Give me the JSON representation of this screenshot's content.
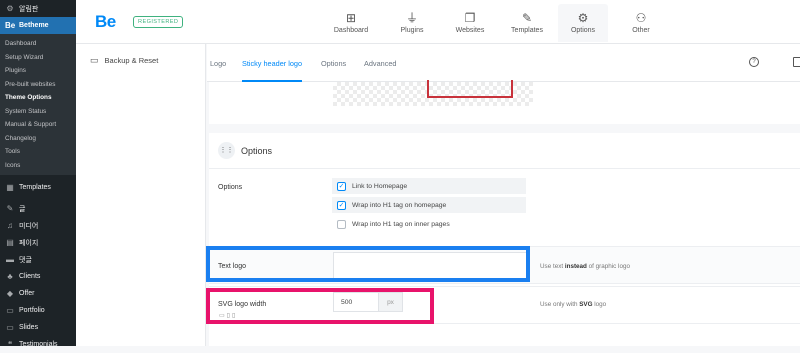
{
  "wp_sidebar": {
    "top_items": [
      {
        "icon": "bell-icon",
        "glyph": "⚙",
        "label": "알림판"
      },
      {
        "icon": "betheme-logo",
        "glyph": "Be",
        "label": "Betheme"
      }
    ],
    "submenu": [
      "Dashboard",
      "Setup Wizard",
      "Plugins",
      "Pre-built websites",
      "Theme Options",
      "System Status",
      "Manual & Support",
      "Changelog",
      "Tools",
      "Icons"
    ],
    "current_submenu": "Theme Options",
    "bottom_items": [
      {
        "icon": "templates-icon",
        "glyph": "▦",
        "label": "Templates"
      },
      {
        "icon": "pin-icon",
        "glyph": "✎",
        "label": "글"
      },
      {
        "icon": "media-icon",
        "glyph": "♫",
        "label": "미디어"
      },
      {
        "icon": "page-icon",
        "glyph": "▤",
        "label": "페이지"
      },
      {
        "icon": "comment-icon",
        "glyph": "▬",
        "label": "댓글"
      },
      {
        "icon": "clients-icon",
        "glyph": "♣",
        "label": "Clients"
      },
      {
        "icon": "offer-icon",
        "glyph": "◆",
        "label": "Offer"
      },
      {
        "icon": "portfolio-icon",
        "glyph": "▭",
        "label": "Portfolio"
      },
      {
        "icon": "slides-icon",
        "glyph": "▭",
        "label": "Slides"
      },
      {
        "icon": "testimonials-icon",
        "glyph": "❝",
        "label": "Testimonials"
      }
    ]
  },
  "header": {
    "logo": "Be",
    "badge": "REGISTERED",
    "tabs": [
      {
        "icon": "dashboard-icon",
        "glyph": "⊞",
        "label": "Dashboard"
      },
      {
        "icon": "plugins-icon",
        "glyph": "⏚",
        "label": "Plugins"
      },
      {
        "icon": "websites-icon",
        "glyph": "❐",
        "label": "Websites"
      },
      {
        "icon": "templates-icon",
        "glyph": "✎",
        "label": "Templates"
      },
      {
        "icon": "options-gear-icon",
        "glyph": "⚙",
        "label": "Options"
      },
      {
        "icon": "other-icon",
        "glyph": "⚇",
        "label": "Other"
      }
    ],
    "active_tab": "Options"
  },
  "left_panel": {
    "backup_label": "Backup & Reset"
  },
  "subtabs": [
    "Logo",
    "Sticky header logo",
    "Options",
    "Advanced"
  ],
  "active_subtab": "Sticky header logo",
  "options_section": {
    "title": "Options",
    "options_label": "Options",
    "checkboxes": [
      {
        "label": "Link to Homepage",
        "checked": true
      },
      {
        "label": "Wrap into H1 tag on homepage",
        "checked": true
      },
      {
        "label": "Wrap into H1 tag on inner pages",
        "checked": false
      }
    ],
    "text_logo": {
      "label": "Text logo",
      "value": "",
      "hint_pre": "Use text ",
      "hint_bold": "instead",
      "hint_post": " of graphic logo"
    },
    "svg_width": {
      "label": "SVG logo width",
      "value": "500",
      "unit": "px",
      "hint_pre": "Use only with ",
      "hint_bold": "SVG",
      "hint_post": " logo"
    }
  },
  "colors": {
    "accent": "#0089f7",
    "wp_active": "#2271b1",
    "highlight_blue": "#1a7ff0",
    "highlight_pink": "#e8136b",
    "preview_red": "#c8323b"
  }
}
